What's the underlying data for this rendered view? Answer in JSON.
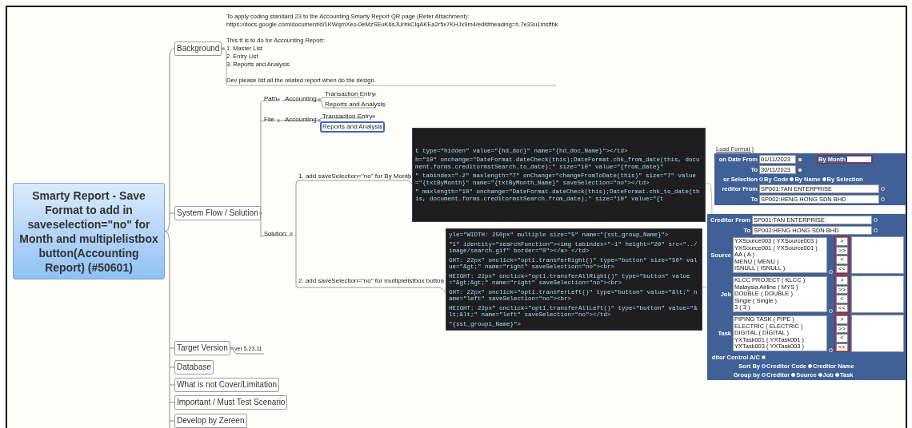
{
  "central_topic": "Smarty Report - Save Format to add in saveselection=\"no\" for Month and multiplelistbox button(Accounting Report) (#50601)",
  "branches": [
    {
      "kind": "note",
      "label": "Background",
      "note": [
        [
          "To apply coding standard 23 to the Accounting Smarty Report QR page (Refer Attachment):",
          "https://docs.google.com/document/d/1KWqmXeo-0eMzSEuK6sJUrlrkClqAKEa2r5x7KHJx9m4/edit#heading=h.7e33u1msftbk"
        ],
        [
          "This tt is to do for Accounting Report:",
          "1. Master List",
          "2. Entry List",
          "3. Reports and Analysis"
        ],
        [
          "Dev please list all the related report when do the design."
        ]
      ]
    },
    {
      "kind": "flow",
      "label": "System Flow / Solution",
      "groups": [
        {
          "label": "Path",
          "module": "Accounting",
          "items": [
            {
              "label": "Transaction Entry",
              "selected": false
            },
            {
              "label": "Reports and Analysis",
              "selected": false
            }
          ]
        },
        {
          "label": "File",
          "module": "Accounting",
          "items": [
            {
              "label": "Transaction Entry",
              "selected": false
            },
            {
              "label": "Reports and Analysis",
              "selected": true
            }
          ]
        }
      ],
      "solution": {
        "label": "Solution:",
        "steps": [
          {
            "label": "1. add saveSelection=\"no\" for By Month",
            "code": [
              "t type=\"hidden\" value=\"{hd_doc}\" name=\"{hd_doc_Name}\"></td>",
              "h=\"10\" onchange=\"DateFormat.dateCheck(this);DateFormat.chk_from_date(this, document.forms.creditormstSearch.to_date);\" size=\"10\" value=\"{from_date}\"",
              "\" tabindex=\"-2\" maxlength=\"7\" onChange=\"changeFromToDate(this)\" size=\"7\" value=\"{txtByMonth}\" name=\"{txtByMonth_Name}\" saveSelection=\"no\"></td>",
              "\" maxlength=\"10\" onchange=\"DateFormat.dateCheck(this);DateFormat.chk_to_date(this, document.forms.creditormstSearch.from_date);\" size=\"10\" value=\"{t"
            ],
            "form": {
              "link": "Load Format )",
              "date_from_label": "on Date From",
              "date_from": "01/11/2023",
              "by_month_label": "By Month",
              "date_to_label": "To",
              "date_to": "30/11/2023",
              "selection_label": "or Selection",
              "selection_options": [
                {
                  "label": "By Code",
                  "selected": true
                },
                {
                  "label": "By Name",
                  "selected": false
                },
                {
                  "label": "By Selection",
                  "selected": false
                }
              ],
              "creditor_from_label": "reditor From",
              "creditor_from": "SP001:TAN ENTERPRISE",
              "creditor_to_label": "To",
              "creditor_to": "SP002:HENG HONG SDN BHD"
            }
          },
          {
            "label": "2. add saveSelection=\"no\" for multiplelistbox button",
            "code": [
              "yle=\"WIDTH: 250px\" multiple size=\"5\" name=\"{sst_group_Name}\">",
              "\"1\" identity=\"searchFunction\"><img tabindex=\"-1\" height=\"20\" src=\"../image/search.gif\" border=\"0\"></a> </td>",
              "GHT: 22px\" onclick=\"opt1.transferRight()\" type=\"button\" size=\"50\" value=\"&gt;\" name=\"right\" saveSelection=\"no\"><br>",
              " HEIGHT: 22px\" onclick=\"opt1.transferAllRight()\" type=\"button\" value=\"&gt;&gt;\" name=\"right\" saveSelection=\"no\"><br>",
              "GHT: 22px\" onclick=\"opt1.transferLeft()\" type=\"button\" value=\"&lt;\" name=\"left\" saveSelection=\"no\"><br>",
              "HEIGHT: 22px\" onclick=\"opt1.transferAllLeft()\" type=\"button\" value=\"&lt;&lt;\" name=\"left\" saveSelection=\"no\"></td>",
              "\"{sst_group1_Name}\">"
            ],
            "form": {
              "creditor_from_label": "Creditor From",
              "creditor_from": "SP001:TAN ENTERPRISE",
              "creditor_to_label": "To",
              "creditor_to": "SP002:HENG HONG SDN BHD",
              "lists": [
                {
                  "label": "Source",
                  "items": [
                    "YXSource003 ( YXSource003 )",
                    "YXSource001 ( YXSource001 )",
                    "AA ( A )",
                    "MENU ( MENU )",
                    "ISNULL ( ISNULL )"
                  ],
                  "buttons": [
                    ">",
                    ">>",
                    "<",
                    "<<"
                  ]
                },
                {
                  "label": "Job",
                  "items": [
                    "KLCC PROJECT ( KLCC )",
                    "Malaysia Airline ( MYS )",
                    "DOUBLE ( DOUBLE )",
                    "Single ( Single )",
                    "3 ( 3 )"
                  ],
                  "buttons": [
                    ">",
                    ">>",
                    "<",
                    "<<"
                  ]
                },
                {
                  "label": "Task",
                  "items": [
                    "PIPING TASK ( PIPE )",
                    "ELECTRIC ( ELECTRIC )",
                    "DIGITAL ( DIGITAL )",
                    "YXTask001 ( YXTask001 )",
                    "YXTask003 ( YXTask003 )"
                  ],
                  "buttons": [
                    ">",
                    ">>",
                    "<",
                    "<<"
                  ]
                }
              ],
              "control_label": "ditor Control A/C",
              "control_checked": false,
              "sort_label": "Sort By",
              "sort_options": [
                {
                  "label": "Creditor Code",
                  "selected": true
                },
                {
                  "label": "Creditor Name",
                  "selected": false
                }
              ],
              "group_label": "Group by",
              "group_options": [
                {
                  "label": "Creditor",
                  "selected": true
                },
                {
                  "label": "Source",
                  "selected": false
                },
                {
                  "label": "Job",
                  "selected": false
                },
                {
                  "label": "Task",
                  "selected": false
                }
              ]
            }
          }
        ]
      }
    },
    {
      "kind": "value",
      "label": "Target Version",
      "value": "ver 5.23.11"
    },
    {
      "kind": "plain",
      "label": "Database"
    },
    {
      "kind": "plain",
      "label": "What is not Cover/Limitation"
    },
    {
      "kind": "plain",
      "label": "Important / Must Test Scenario"
    },
    {
      "kind": "plain",
      "label": "Develop by Zereen"
    }
  ]
}
